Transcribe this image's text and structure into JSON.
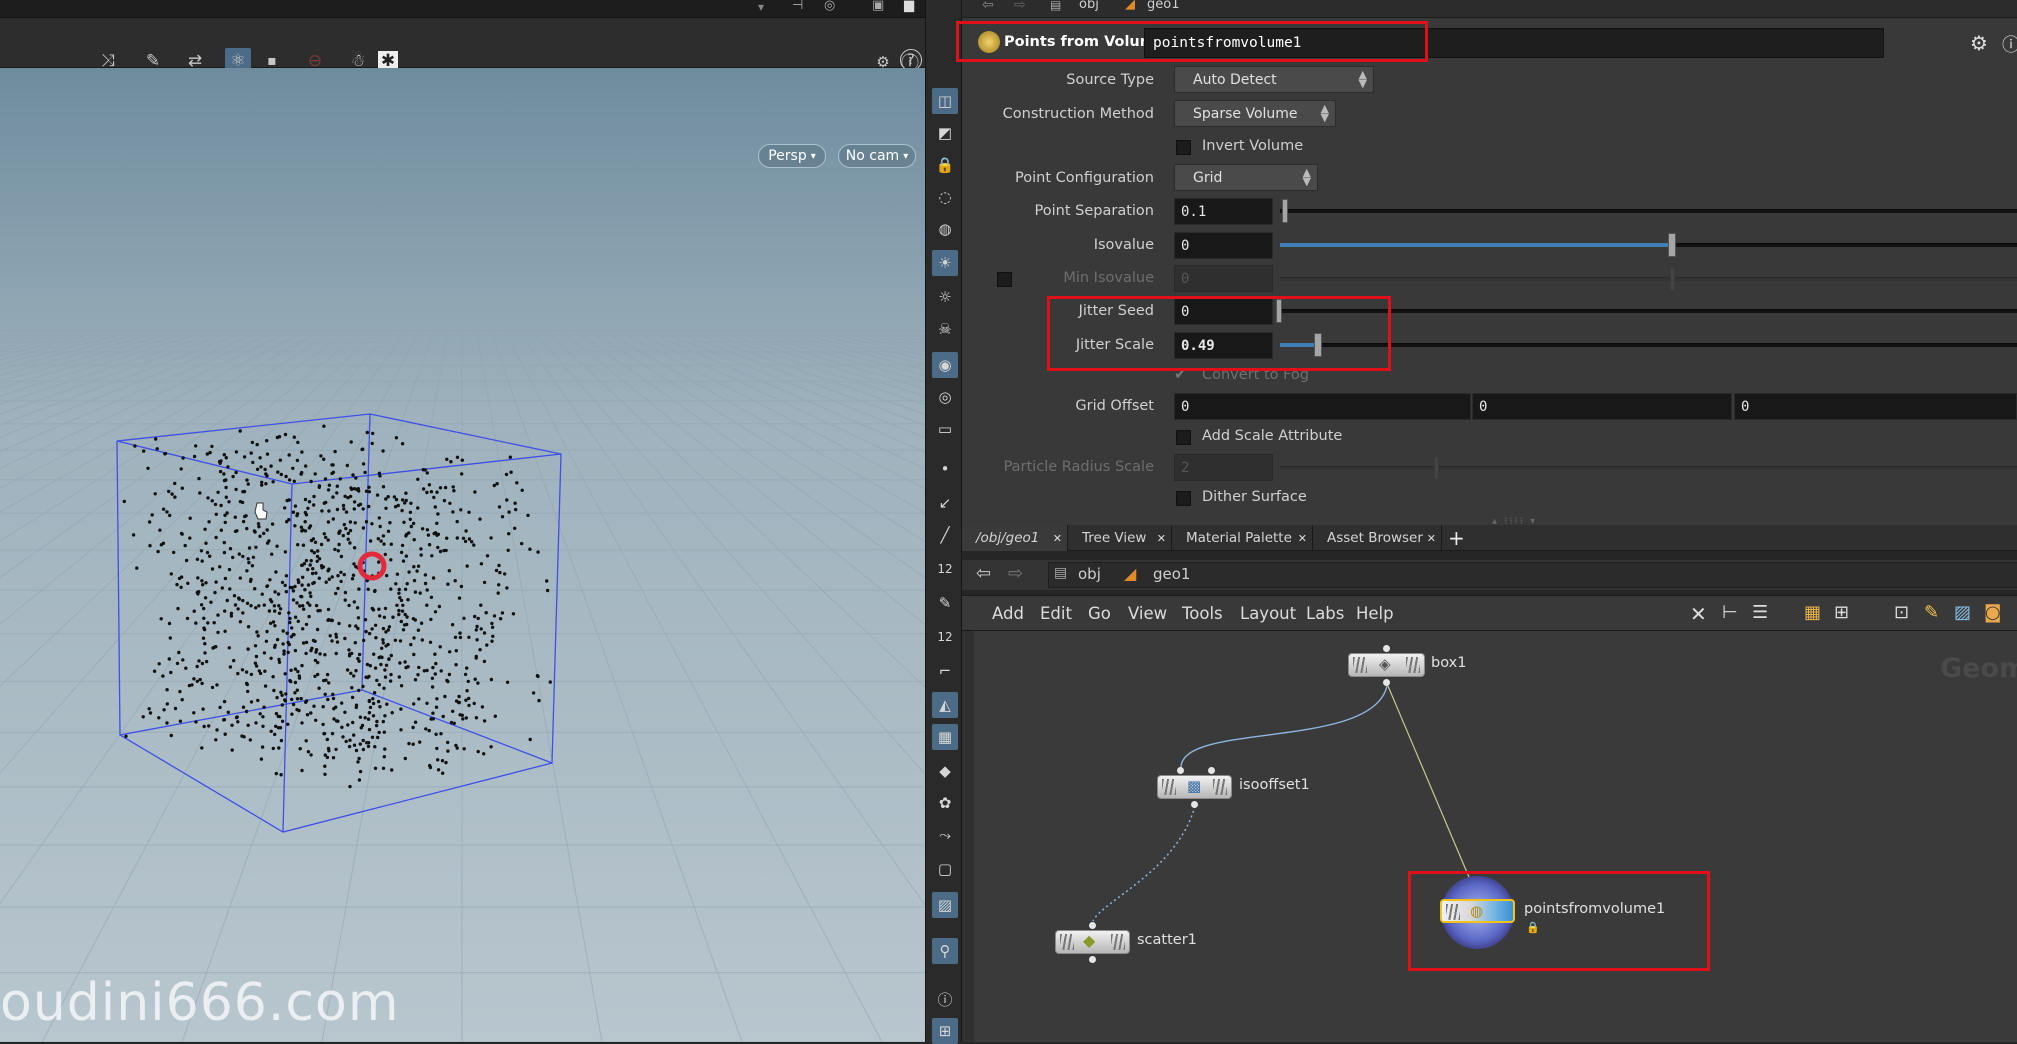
{
  "viewport": {
    "persp_label": "Persp",
    "cam_label": "No cam",
    "watermark": "oudini666.com"
  },
  "params": {
    "path_obj": "obj",
    "path_geo": "geo1",
    "node_type": "Points from Volume",
    "node_name": "pointsfromvolume1",
    "source_type_label": "Source Type",
    "source_type_value": "Auto Detect",
    "construction_label": "Construction Method",
    "construction_value": "Sparse Volume",
    "invert_volume_label": "Invert Volume",
    "point_config_label": "Point Configuration",
    "point_config_value": "Grid",
    "point_sep_label": "Point Separation",
    "point_sep_value": "0.1",
    "isovalue_label": "Isovalue",
    "isovalue_value": "0",
    "min_iso_label": "Min Isovalue",
    "min_iso_value": "0",
    "jitter_seed_label": "Jitter Seed",
    "jitter_seed_value": "0",
    "jitter_scale_label": "Jitter Scale",
    "jitter_scale_value": "0.49",
    "convert_fog_label": "Convert to Fog",
    "grid_offset_label": "Grid Offset",
    "grid_offset_x": "0",
    "grid_offset_y": "0",
    "grid_offset_z": "0",
    "add_scale_label": "Add Scale Attribute",
    "particle_radius_label": "Particle Radius Scale",
    "particle_radius_value": "2",
    "dither_label": "Dither Surface"
  },
  "tabs": [
    {
      "label": "/obj/geo1"
    },
    {
      "label": "Tree View"
    },
    {
      "label": "Material Palette"
    },
    {
      "label": "Asset Browser"
    }
  ],
  "net_path": {
    "obj": "obj",
    "geo": "geo1"
  },
  "net_menu": [
    "Add",
    "Edit",
    "Go",
    "View",
    "Tools",
    "Layout",
    "Labs",
    "Help"
  ],
  "network": {
    "context_label": "Geom",
    "nodes": {
      "box": "box1",
      "isooffset": "isooffset1",
      "scatter": "scatter1",
      "pfv": "pointsfromvolume1"
    }
  },
  "colors": {
    "highlight_red": "#e0101a",
    "accent_blue": "#3e7fb5",
    "selected_yellow": "#f3c21a"
  }
}
